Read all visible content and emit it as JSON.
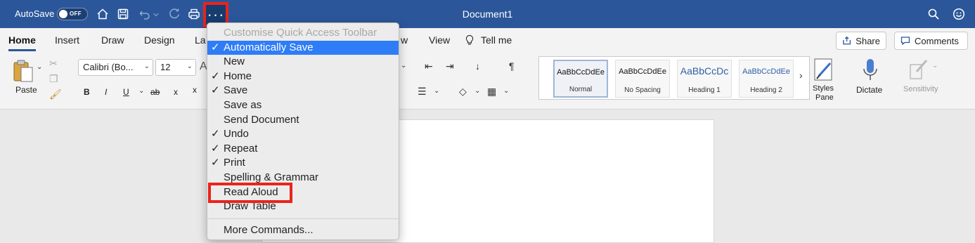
{
  "titlebar": {
    "autosave_label": "AutoSave",
    "autosave_state": "OFF",
    "doc_title": "Document1",
    "more_glyph": "···",
    "icons": [
      "home-icon",
      "save-icon",
      "undo-icon",
      "redo-icon",
      "print-icon",
      "more-options-icon",
      "search-icon",
      "smiley-icon"
    ]
  },
  "tabs": [
    "Home",
    "Insert",
    "Draw",
    "Design",
    "La",
    "w",
    "View"
  ],
  "tell_me": "Tell me",
  "share_label": "Share",
  "comments_label": "Comments",
  "ribbon": {
    "paste_label": "Paste",
    "font_name": "Calibri (Bo...",
    "font_size": "12",
    "font_buttons": [
      "B",
      "I",
      "U",
      "ab",
      "x",
      "x"
    ],
    "styles": [
      {
        "sample": "AaBbCcDdEe",
        "name": "Normal"
      },
      {
        "sample": "AaBbCcDdEe",
        "name": "No Spacing"
      },
      {
        "sample": "AaBbCcDc",
        "name": "Heading 1"
      },
      {
        "sample": "AaBbCcDdEe",
        "name": "Heading 2"
      }
    ],
    "styles_pane_1": "Styles",
    "styles_pane_2": "Pane",
    "dictate_label": "Dictate",
    "sensitivity_label": "Sensitivity"
  },
  "menu": {
    "items": [
      {
        "label": "Customise Quick Access Toolbar",
        "checked": "",
        "state": "disabled"
      },
      {
        "label": "Automatically Save",
        "checked": "✓",
        "state": "highlight"
      },
      {
        "label": "New",
        "checked": "",
        "state": ""
      },
      {
        "label": "Home",
        "checked": "✓",
        "state": ""
      },
      {
        "label": "Save",
        "checked": "✓",
        "state": ""
      },
      {
        "label": "Save as",
        "checked": "",
        "state": ""
      },
      {
        "label": "Send Document",
        "checked": "",
        "state": ""
      },
      {
        "label": "Undo",
        "checked": "✓",
        "state": ""
      },
      {
        "label": "Repeat",
        "checked": "✓",
        "state": ""
      },
      {
        "label": "Print",
        "checked": "✓",
        "state": ""
      },
      {
        "label": "Spelling & Grammar",
        "checked": "",
        "state": ""
      },
      {
        "label": "Read Aloud",
        "checked": "",
        "state": ""
      },
      {
        "label": "Draw Table",
        "checked": "",
        "state": ""
      }
    ],
    "more_commands": "More Commands..."
  },
  "colors": {
    "titlebar": "#2b579a",
    "highlight": "#2f7df6",
    "callout": "#e8241c"
  }
}
